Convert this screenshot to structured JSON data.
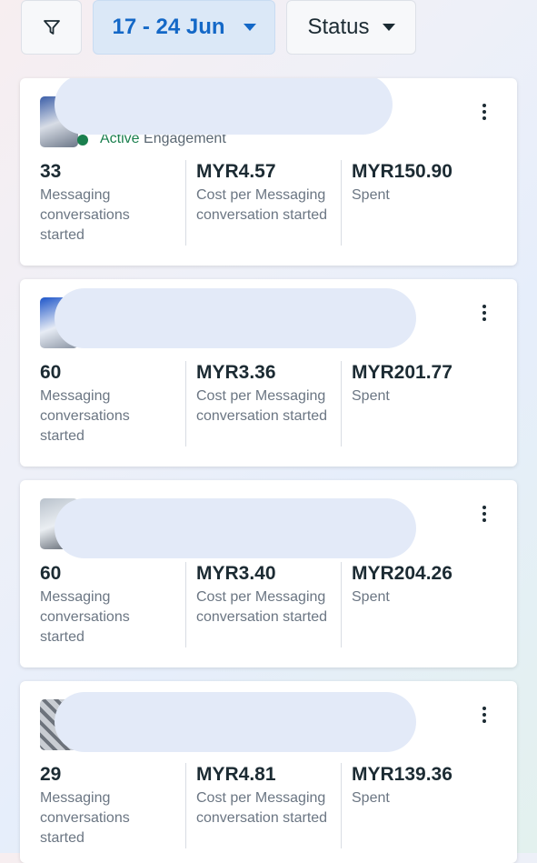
{
  "toolbar": {
    "filter_icon": "filter-funnel-icon",
    "date_range": "17 - 24 Jun",
    "status_label": "Status",
    "accent_color": "#1468c7"
  },
  "status_colors": {
    "active": "#1a7f4e"
  },
  "campaigns": [
    {
      "status": "Active",
      "objective": "Engagement",
      "metrics": [
        {
          "value": "33",
          "label": "Messaging conversations started"
        },
        {
          "value": "MYR4.57",
          "label": "Cost per Messaging conversation started"
        },
        {
          "value": "MYR150.90",
          "label": "Spent"
        }
      ]
    },
    {
      "metrics": [
        {
          "value": "60",
          "label": "Messaging conversations started"
        },
        {
          "value": "MYR3.36",
          "label": "Cost per Messaging conversation started"
        },
        {
          "value": "MYR201.77",
          "label": "Spent"
        }
      ]
    },
    {
      "metrics": [
        {
          "value": "60",
          "label": "Messaging conversations started"
        },
        {
          "value": "MYR3.40",
          "label": "Cost per Messaging conversation started"
        },
        {
          "value": "MYR204.26",
          "label": "Spent"
        }
      ]
    },
    {
      "metrics": [
        {
          "value": "29",
          "label": "Messaging conversations started"
        },
        {
          "value": "MYR4.81",
          "label": "Cost per Messaging conversation started"
        },
        {
          "value": "MYR139.36",
          "label": "Spent"
        }
      ]
    }
  ]
}
